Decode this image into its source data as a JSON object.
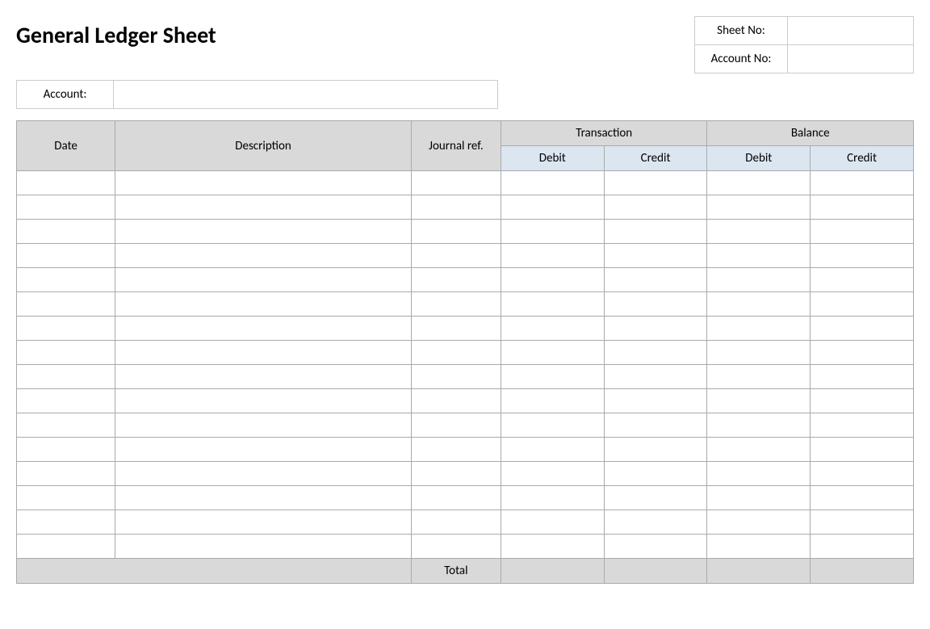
{
  "title": "General Ledger Sheet",
  "header": {
    "account_label": "Account:",
    "sheet_no_label": "Sheet No:",
    "account_no_label": "Account No:",
    "account_value": "",
    "sheet_no_value": "",
    "account_no_value": ""
  },
  "table": {
    "columns": {
      "date": "Date",
      "description": "Description",
      "journal_ref": "Journal ref.",
      "transaction": "Transaction",
      "balance": "Balance",
      "debit": "Debit",
      "credit": "Credit"
    },
    "total_label": "Total",
    "row_count": 16
  }
}
